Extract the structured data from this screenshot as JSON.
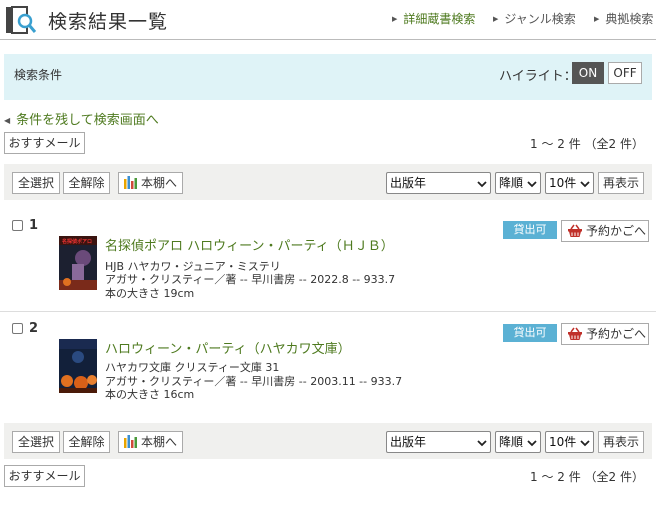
{
  "header": {
    "title": "検索結果一覧",
    "nav": [
      {
        "label": "詳細蔵書検索"
      },
      {
        "label": "ジャンル検索"
      },
      {
        "label": "典拠検索"
      }
    ]
  },
  "conditions": {
    "label": "検索条件",
    "highlight_label": "ハイライト：",
    "on": "ON",
    "off": "OFF"
  },
  "back_link": "条件を残して検索画面へ",
  "recommend": "おすすメール",
  "count_text": "1 ～ 2 件 （全2 件）",
  "toolbar": {
    "select_all": "全選択",
    "unselect_all": "全解除",
    "to_shelf": "本棚へ",
    "sort_value": "出版年",
    "order_value": "降順",
    "per_page_value": "10件",
    "redisplay": "再表示"
  },
  "records": [
    {
      "num": "1",
      "title": "名探偵ポアロ ハロウィーン・パーティ（ＨＪＢ）",
      "series": "HJB ハヤカワ・ジュニア・ミステリ",
      "author_line": "アガサ・クリスティー／著 -- 早川書房 -- 2022.8 -- 933.7",
      "size": "本の大きさ 19cm",
      "status": "貸出可",
      "basket": "予約かごへ"
    },
    {
      "num": "2",
      "title": "ハロウィーン・パーティ（ハヤカワ文庫）",
      "series": "ハヤカワ文庫 クリスティー文庫 31",
      "author_line": "アガサ・クリスティー／著 -- 早川書房 -- 2003.11 -- 933.7",
      "size": "本の大きさ 16cm",
      "status": "貸出可",
      "basket": "予約かごへ"
    }
  ],
  "colors": {
    "accent_green": "#4e7a1f",
    "status_blue": "#5bb1d4",
    "condition_bg": "#dff3f7"
  },
  "icons": {
    "logo": "book-search-icon",
    "shelf": "bar-chart-icon",
    "basket": "shopping-basket-icon"
  }
}
